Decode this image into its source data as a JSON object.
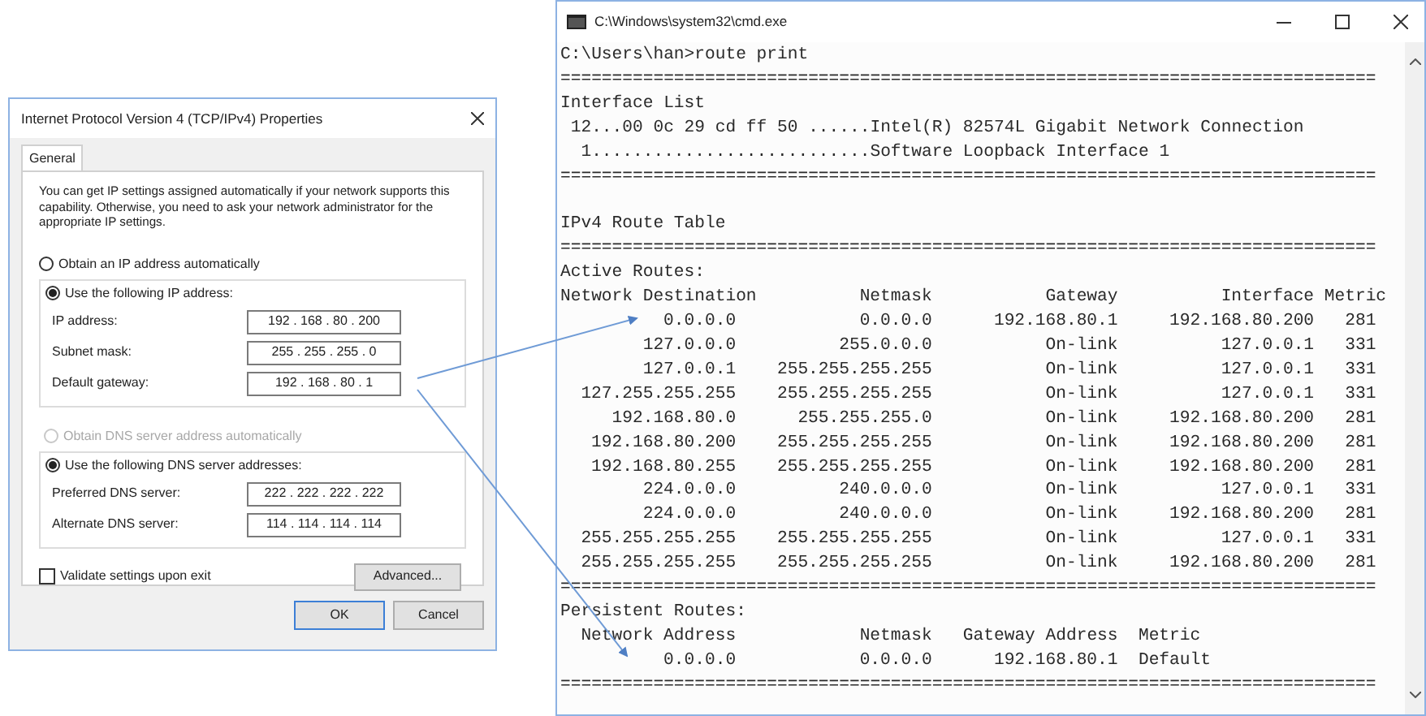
{
  "dialog": {
    "title": "Internet Protocol Version 4 (TCP/IPv4) Properties",
    "tabs": [
      {
        "label": "General",
        "selected": true
      }
    ],
    "intro": "You can get IP settings assigned automatically if your network supports this capability. Otherwise, you need to ask your network administrator for the appropriate IP settings.",
    "ip_options": [
      {
        "label": "Obtain an IP address automatically",
        "selected": false,
        "disabled": false
      },
      {
        "label": "Use the following IP address:",
        "selected": true,
        "disabled": false
      }
    ],
    "ip_fields": [
      {
        "label": "IP address:",
        "value": "192 . 168 . 80 . 200"
      },
      {
        "label": "Subnet mask:",
        "value": "255 . 255 . 255 . 0"
      },
      {
        "label": "Default gateway:",
        "value": "192 . 168 . 80 . 1"
      }
    ],
    "dns_options": [
      {
        "label": "Obtain DNS server address automatically",
        "selected": false,
        "disabled": true
      },
      {
        "label": "Use the following DNS server addresses:",
        "selected": true,
        "disabled": false
      }
    ],
    "dns_fields": [
      {
        "label": "Preferred DNS server:",
        "value": "222 . 222 . 222 . 222"
      },
      {
        "label": "Alternate DNS server:",
        "value": "114 . 114 . 114 . 114"
      }
    ],
    "validate": {
      "label": "Validate settings upon exit",
      "checked": false
    },
    "advanced_button": "Advanced...",
    "buttons": [
      {
        "label": "OK",
        "default": true
      },
      {
        "label": "Cancel",
        "default": false
      }
    ]
  },
  "console": {
    "title": "C:\\Windows\\system32\\cmd.exe",
    "lines": [
      {
        "kind": "text",
        "text": "C:\\Users\\han>route print"
      },
      {
        "kind": "separator",
        "text": "==============================================================================="
      },
      {
        "kind": "text",
        "text": "Interface List"
      },
      {
        "kind": "text",
        "text": " 12...00 0c 29 cd ff 50 ......Intel(R) 82574L Gigabit Network Connection"
      },
      {
        "kind": "text",
        "text": "  1...........................Software Loopback Interface 1"
      },
      {
        "kind": "separator",
        "text": "==============================================================================="
      },
      {
        "kind": "blank"
      },
      {
        "kind": "text",
        "text": "IPv4 Route Table"
      },
      {
        "kind": "separator",
        "text": "==============================================================================="
      },
      {
        "kind": "text",
        "text": "Active Routes:"
      },
      {
        "kind": "active_routes",
        "header": [
          "Network Destination",
          "Netmask",
          "Gateway",
          "Interface",
          "Metric"
        ],
        "rows": [
          [
            "0.0.0.0",
            "0.0.0.0",
            "192.168.80.1",
            "192.168.80.200",
            "281"
          ],
          [
            "127.0.0.0",
            "255.0.0.0",
            "On-link",
            "127.0.0.1",
            "331"
          ],
          [
            "127.0.0.1",
            "255.255.255.255",
            "On-link",
            "127.0.0.1",
            "331"
          ],
          [
            "127.255.255.255",
            "255.255.255.255",
            "On-link",
            "127.0.0.1",
            "331"
          ],
          [
            "192.168.80.0",
            "255.255.255.0",
            "On-link",
            "192.168.80.200",
            "281"
          ],
          [
            "192.168.80.200",
            "255.255.255.255",
            "On-link",
            "192.168.80.200",
            "281"
          ],
          [
            "192.168.80.255",
            "255.255.255.255",
            "On-link",
            "192.168.80.200",
            "281"
          ],
          [
            "224.0.0.0",
            "240.0.0.0",
            "On-link",
            "127.0.0.1",
            "331"
          ],
          [
            "224.0.0.0",
            "240.0.0.0",
            "On-link",
            "192.168.80.200",
            "281"
          ],
          [
            "255.255.255.255",
            "255.255.255.255",
            "On-link",
            "127.0.0.1",
            "331"
          ],
          [
            "255.255.255.255",
            "255.255.255.255",
            "On-link",
            "192.168.80.200",
            "281"
          ]
        ]
      },
      {
        "kind": "separator",
        "text": "==============================================================================="
      },
      {
        "kind": "text",
        "text": "Persistent Routes:"
      },
      {
        "kind": "persistent_routes",
        "header": [
          "Network Address",
          "Netmask",
          "Gateway Address",
          "Metric"
        ],
        "rows": [
          [
            "0.0.0.0",
            "0.0.0.0",
            "192.168.80.1",
            "Default"
          ]
        ]
      },
      {
        "kind": "separator",
        "text": "==============================================================================="
      }
    ]
  }
}
